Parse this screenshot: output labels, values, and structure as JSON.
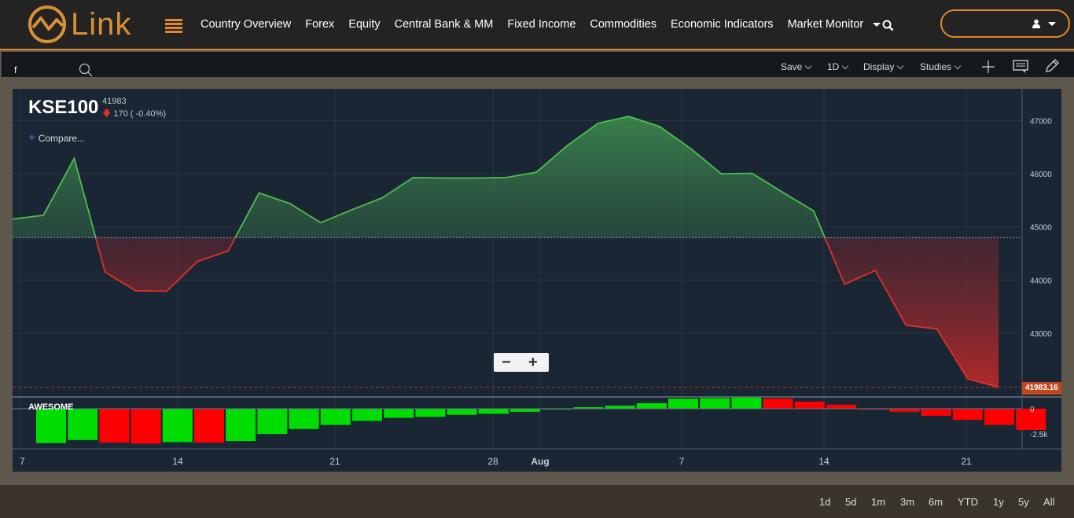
{
  "header": {
    "logo_text": "Link",
    "nav": [
      "Country Overview",
      "Forex",
      "Equity",
      "Central Bank & MM",
      "Fixed Income",
      "Commodities",
      "Economic Indicators",
      "Market Monitor"
    ]
  },
  "toolbar": {
    "symbol_input": "f",
    "save": "Save",
    "interval": "1D",
    "display": "Display",
    "studies": "Studies"
  },
  "chart_header": {
    "symbol": "KSE100",
    "price": "41983",
    "change": "170 ( -0.40%)",
    "compare": "Compare...",
    "last_label": "41983.16",
    "indicator": "AWESOME"
  },
  "ranges": [
    "1d",
    "5d",
    "1m",
    "3m",
    "6m",
    "YTD",
    "1y",
    "5y",
    "All"
  ],
  "colors": {
    "accent": "#e08a2c",
    "up": "#4cc04e",
    "down": "#e0302a",
    "bar_up": "#00dd00",
    "bar_down": "#ff0000"
  },
  "chart_data": [
    {
      "type": "area",
      "title": "KSE100",
      "baseline": 44800,
      "ylim": [
        41800,
        47600
      ],
      "yticks": [
        "47000",
        "46000",
        "45000",
        "44000",
        "43000"
      ],
      "xticks": [
        "7",
        "14",
        "21",
        "28",
        "Aug",
        "7",
        "14",
        "21"
      ],
      "series": [
        {
          "values": [
            45150,
            45220,
            46290,
            44150,
            43800,
            43790,
            44350,
            44550,
            45640,
            45440,
            45080,
            45320,
            45550,
            45930,
            45920,
            45920,
            45930,
            46030,
            46530,
            46950,
            47080,
            46890,
            46480,
            46000,
            46010,
            45650,
            45300,
            43920,
            44180,
            43150,
            43080,
            42140,
            41983
          ]
        }
      ]
    },
    {
      "type": "bar",
      "title": "AWESOME",
      "yticks": [
        "0",
        "-2.5k"
      ],
      "values": [
        -3400,
        -3100,
        -3350,
        -3450,
        -3300,
        -3350,
        -3200,
        -2500,
        -2000,
        -1600,
        -1200,
        -900,
        -800,
        -600,
        -500,
        -300,
        -50,
        150,
        300,
        550,
        1000,
        1050,
        1100,
        1000,
        700,
        400,
        -50,
        -300,
        -700,
        -1100,
        -1600,
        -2100
      ]
    }
  ]
}
